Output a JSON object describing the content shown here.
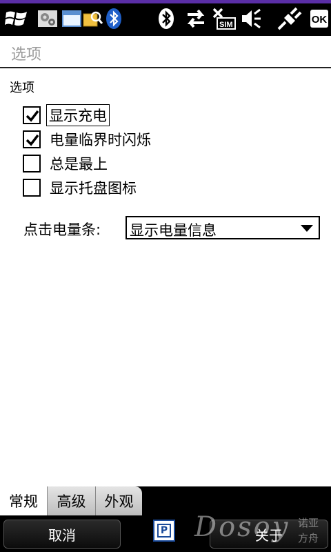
{
  "statusbar": {
    "icons": [
      "windows-start-icon",
      "settings-app-icon",
      "window-app-icon",
      "folder-search-icon",
      "bluetooth-icon",
      "bluetooth-status-icon",
      "data-transfer-icon",
      "no-sim-icon",
      "speaker-icon",
      "power-plug-icon"
    ],
    "ok_label": "OK",
    "sim_label": "SIM",
    "accent": "#5a2ea6"
  },
  "title": "选项",
  "section_label": "选项",
  "options": [
    {
      "label": "显示充电",
      "checked": true,
      "focused": true
    },
    {
      "label": "电量临界时闪烁",
      "checked": true,
      "focused": false
    },
    {
      "label": "总是最上",
      "checked": false,
      "focused": false
    },
    {
      "label": "显示托盘图标",
      "checked": false,
      "focused": false
    }
  ],
  "combo": {
    "label": "点击电量条:",
    "value": "显示电量信息"
  },
  "tabs": [
    {
      "label": "常规",
      "active": true
    },
    {
      "label": "高级",
      "active": false
    },
    {
      "label": "外观",
      "active": false
    }
  ],
  "softkeys": {
    "left": "取消",
    "right": "关于"
  },
  "sip_label": "P",
  "watermark": {
    "text": "Dosoy",
    "sub": "诺亚方舟"
  }
}
